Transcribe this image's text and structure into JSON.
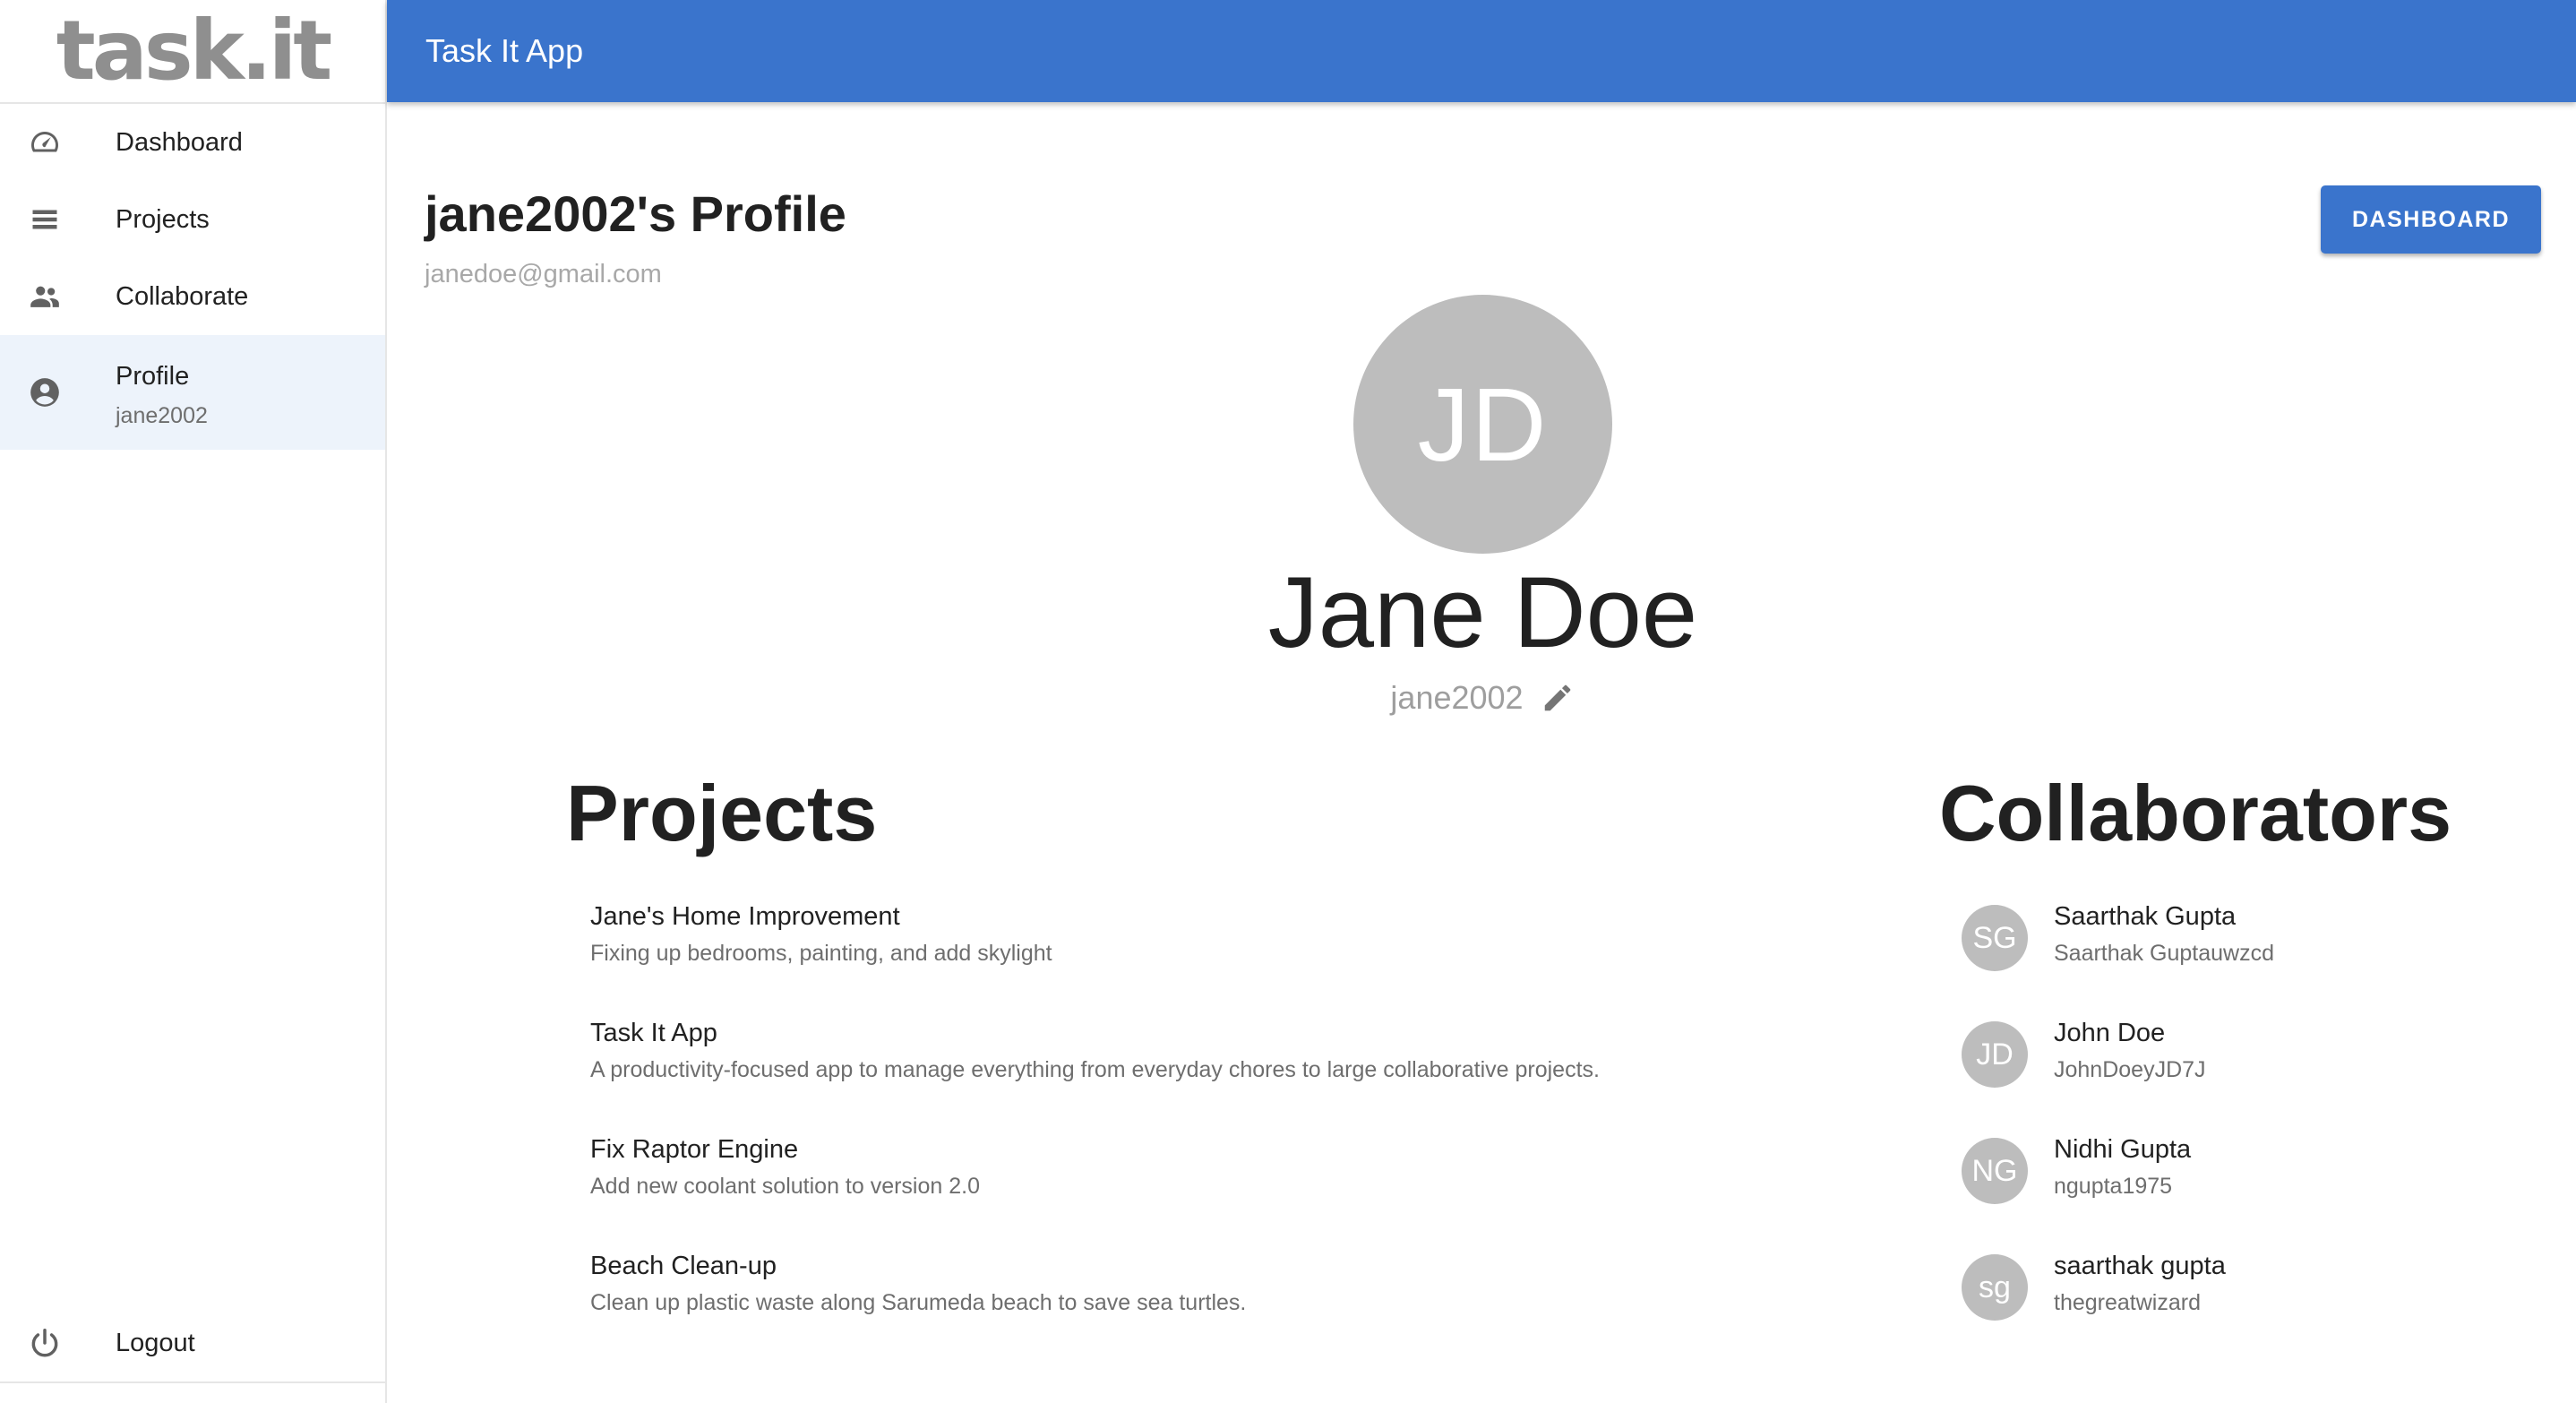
{
  "brand": {
    "logo_text": "task.it"
  },
  "appbar": {
    "title": "Task It App"
  },
  "sidebar": {
    "items": [
      {
        "label": "Dashboard",
        "icon": "speedometer-icon"
      },
      {
        "label": "Projects",
        "icon": "list-icon"
      },
      {
        "label": "Collaborate",
        "icon": "people-icon"
      },
      {
        "label": "Profile",
        "sub": "jane2002",
        "icon": "account-circle-icon",
        "active": true
      }
    ],
    "logout": {
      "label": "Logout",
      "icon": "power-icon"
    }
  },
  "profile": {
    "title": "jane2002's Profile",
    "email": "janedoe@gmail.com",
    "initials": "JD",
    "full_name": "Jane Doe",
    "username": "jane2002",
    "dashboard_button": "DASHBOARD"
  },
  "projects": {
    "heading": "Projects",
    "items": [
      {
        "name": "Jane's Home Improvement",
        "description": "Fixing up bedrooms, painting, and add skylight"
      },
      {
        "name": "Task It App",
        "description": "A productivity-focused app to manage everything from everyday chores to large collaborative projects."
      },
      {
        "name": "Fix Raptor Engine",
        "description": "Add new coolant solution to version 2.0"
      },
      {
        "name": "Beach Clean-up",
        "description": "Clean up plastic waste along Sarumeda beach to save sea turtles."
      }
    ]
  },
  "collaborators": {
    "heading": "Collaborators",
    "items": [
      {
        "initials": "SG",
        "name": "Saarthak Gupta",
        "username": "Saarthak Guptauwzcd"
      },
      {
        "initials": "JD",
        "name": "John Doe",
        "username": "JohnDoeyJD7J"
      },
      {
        "initials": "NG",
        "name": "Nidhi Gupta",
        "username": "ngupta1975"
      },
      {
        "initials": "sg",
        "name": "saarthak gupta",
        "username": "thegreatwizard"
      }
    ]
  },
  "colors": {
    "primary": "#3a74cc",
    "avatar": "#bdbdbd",
    "active_bg": "#edf3fb"
  }
}
